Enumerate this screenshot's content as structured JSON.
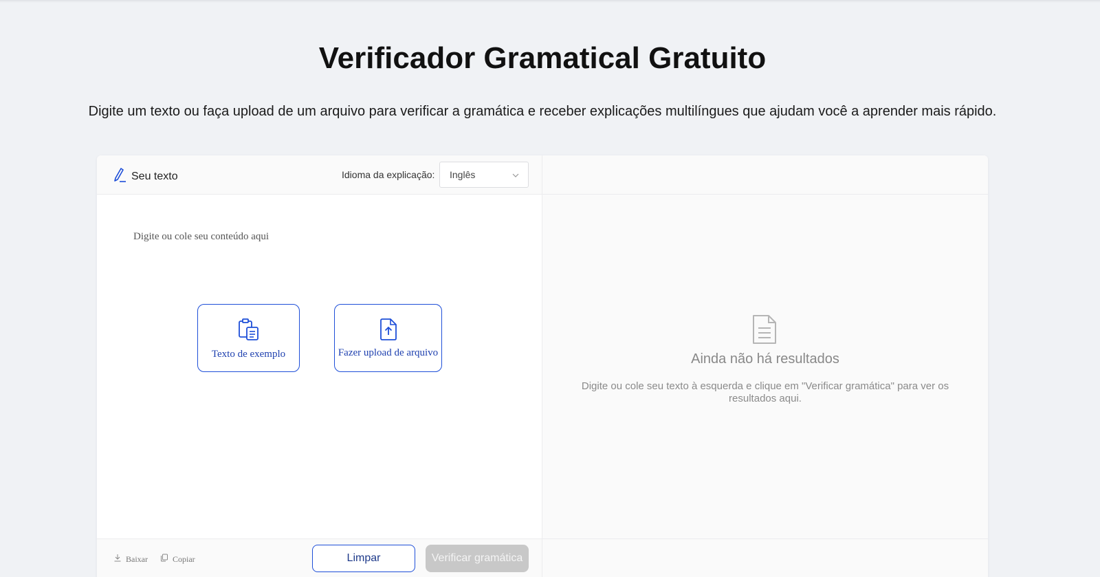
{
  "page": {
    "title": "Verificador Gramatical Gratuito",
    "subtitle": "Digite um texto ou faça upload de um arquivo para verificar a gramática e receber explicações multilíngues que ajudam você a aprender mais rápido."
  },
  "editor": {
    "header_label": "Seu texto",
    "header_icon": "pencil-icon",
    "explanation_language_label": "Idioma da explicação:",
    "explanation_language_value": "Inglês",
    "placeholder": "Digite ou cole seu conteúdo aqui",
    "sample_button_label": "Texto de exemplo",
    "sample_button_icon": "clipboard-icon",
    "upload_button_label": "Fazer upload de arquivo",
    "upload_button_icon": "file-upload-icon"
  },
  "results": {
    "empty_icon": "document-icon",
    "empty_title": "Ainda não há resultados",
    "empty_description": "Digite ou cole seu texto à esquerda e clique em \"Verificar gramática\" para ver os resultados aqui."
  },
  "footer": {
    "download_label": "Baixar",
    "copy_label": "Copiar",
    "clear_label": "Limpar",
    "check_label": "Verificar gramática"
  },
  "colors": {
    "accent": "#1d4ed8",
    "background": "#f0f2f5",
    "disabled_button": "#c8c8c8"
  }
}
